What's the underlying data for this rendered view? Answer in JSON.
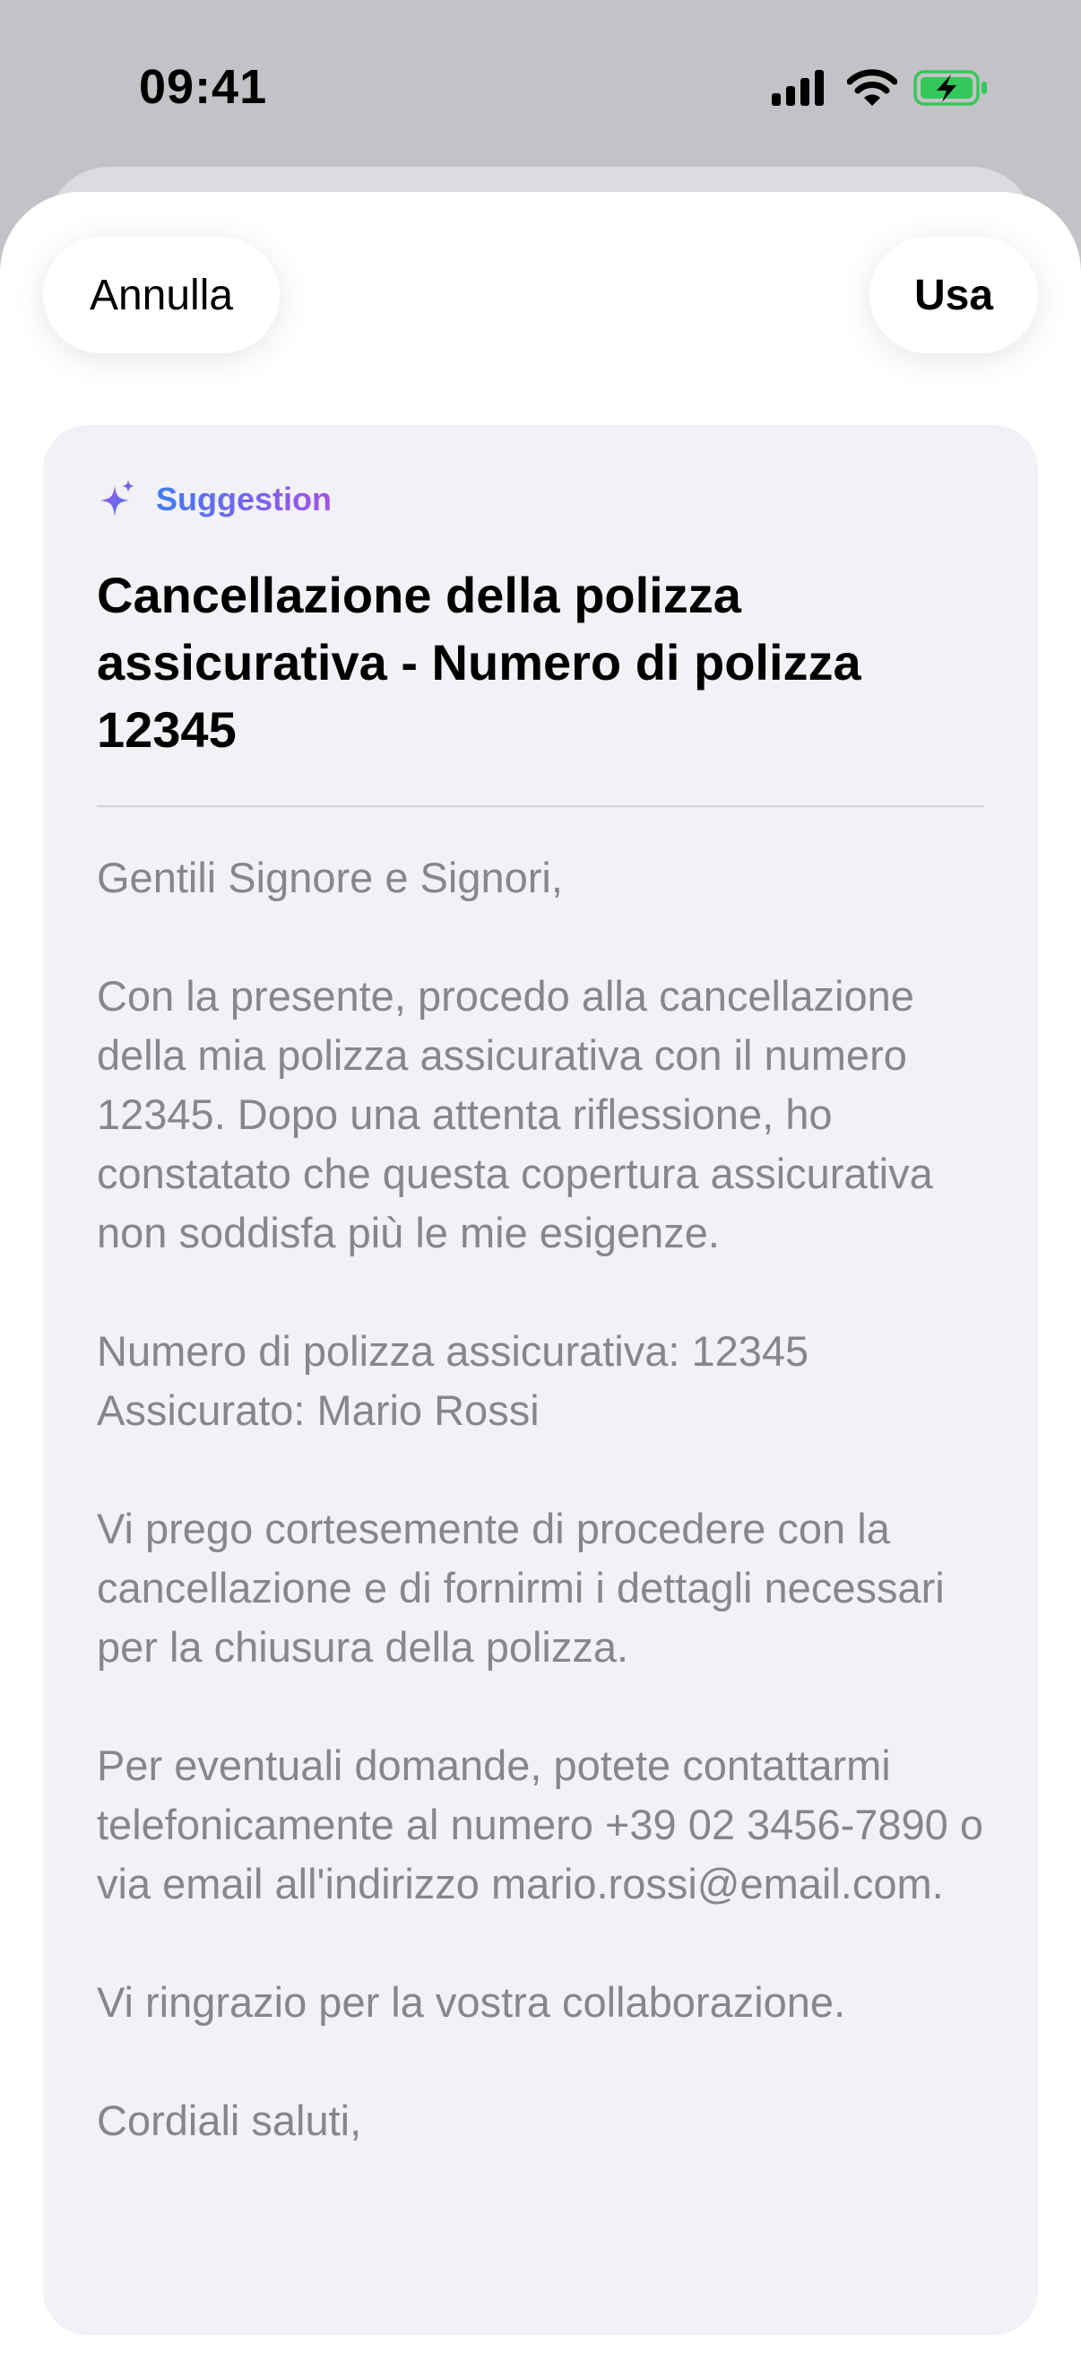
{
  "status_bar": {
    "time": "09:41",
    "icons": [
      "cellular-signal-icon",
      "wifi-icon",
      "battery-charging-icon"
    ],
    "battery_color": "#34c759"
  },
  "toolbar": {
    "cancel_label": "Annulla",
    "use_label": "Usa"
  },
  "suggestion": {
    "label": "Suggestion",
    "icon": "sparkle-icon",
    "gradient": [
      "#3f7cf2",
      "#a551e6"
    ],
    "subject": "Cancellazione della polizza assicurativa - Numero di polizza 12345",
    "paragraphs": [
      "Gentili Signore e Signori,",
      "Con la presente, procedo alla cancellazione della mia polizza assicurativa con il numero 12345. Dopo una attenta riflessione, ho constatato che questa copertura assicurativa non soddisfa più le mie esigenze.",
      "Numero di polizza assicurativa: 12345\nAssicurato: Mario Rossi",
      "Vi prego cortesemente di procedere con la cancellazione e di fornirmi i dettagli necessari per la chiusura della polizza.",
      "Per eventuali domande, potete contattarmi telefonicamente al numero +39 02 3456-7890 o via email all'indirizzo mario.rossi@email.com.",
      "Vi ringrazio per la vostra collaborazione.",
      "Cordiali saluti,"
    ]
  }
}
